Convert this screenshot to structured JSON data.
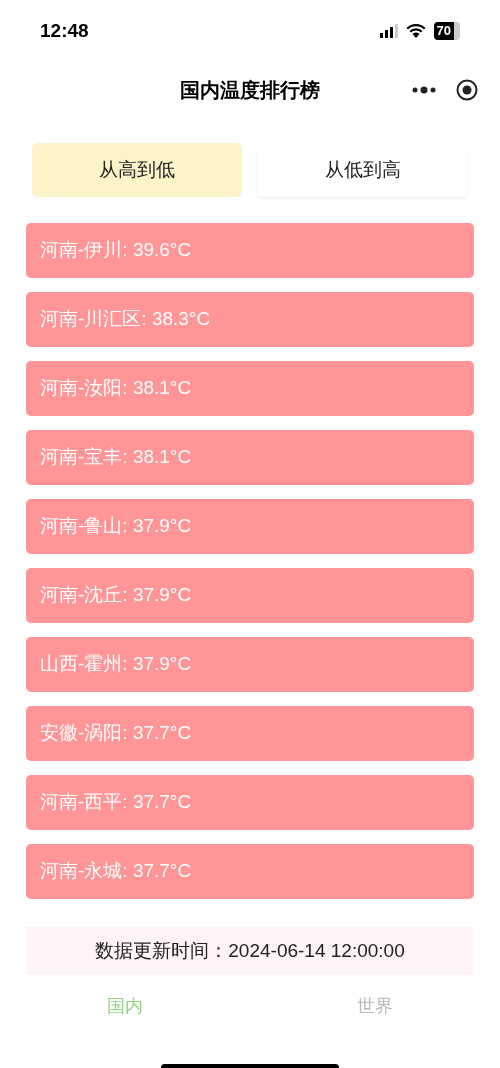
{
  "status_bar": {
    "time": "12:48",
    "battery": "70"
  },
  "header": {
    "title": "国内温度排行榜"
  },
  "sort_tabs": [
    {
      "label": "从高到低",
      "selected": true
    },
    {
      "label": "从低到高",
      "selected": false
    }
  ],
  "ranking": [
    {
      "text": "河南-伊川: 39.6°C"
    },
    {
      "text": "河南-川汇区: 38.3°C"
    },
    {
      "text": "河南-汝阳: 38.1°C"
    },
    {
      "text": "河南-宝丰: 38.1°C"
    },
    {
      "text": "河南-鲁山: 37.9°C"
    },
    {
      "text": "河南-沈丘: 37.9°C"
    },
    {
      "text": "山西-霍州: 37.9°C"
    },
    {
      "text": "安徽-涡阳: 37.7°C"
    },
    {
      "text": "河南-西平: 37.7°C"
    },
    {
      "text": "河南-永城: 37.7°C"
    }
  ],
  "update_note": "数据更新时间：2024-06-14 12:00:00",
  "tab_bar": [
    {
      "label": "国内",
      "selected": true
    },
    {
      "label": "世界",
      "selected": false
    }
  ]
}
